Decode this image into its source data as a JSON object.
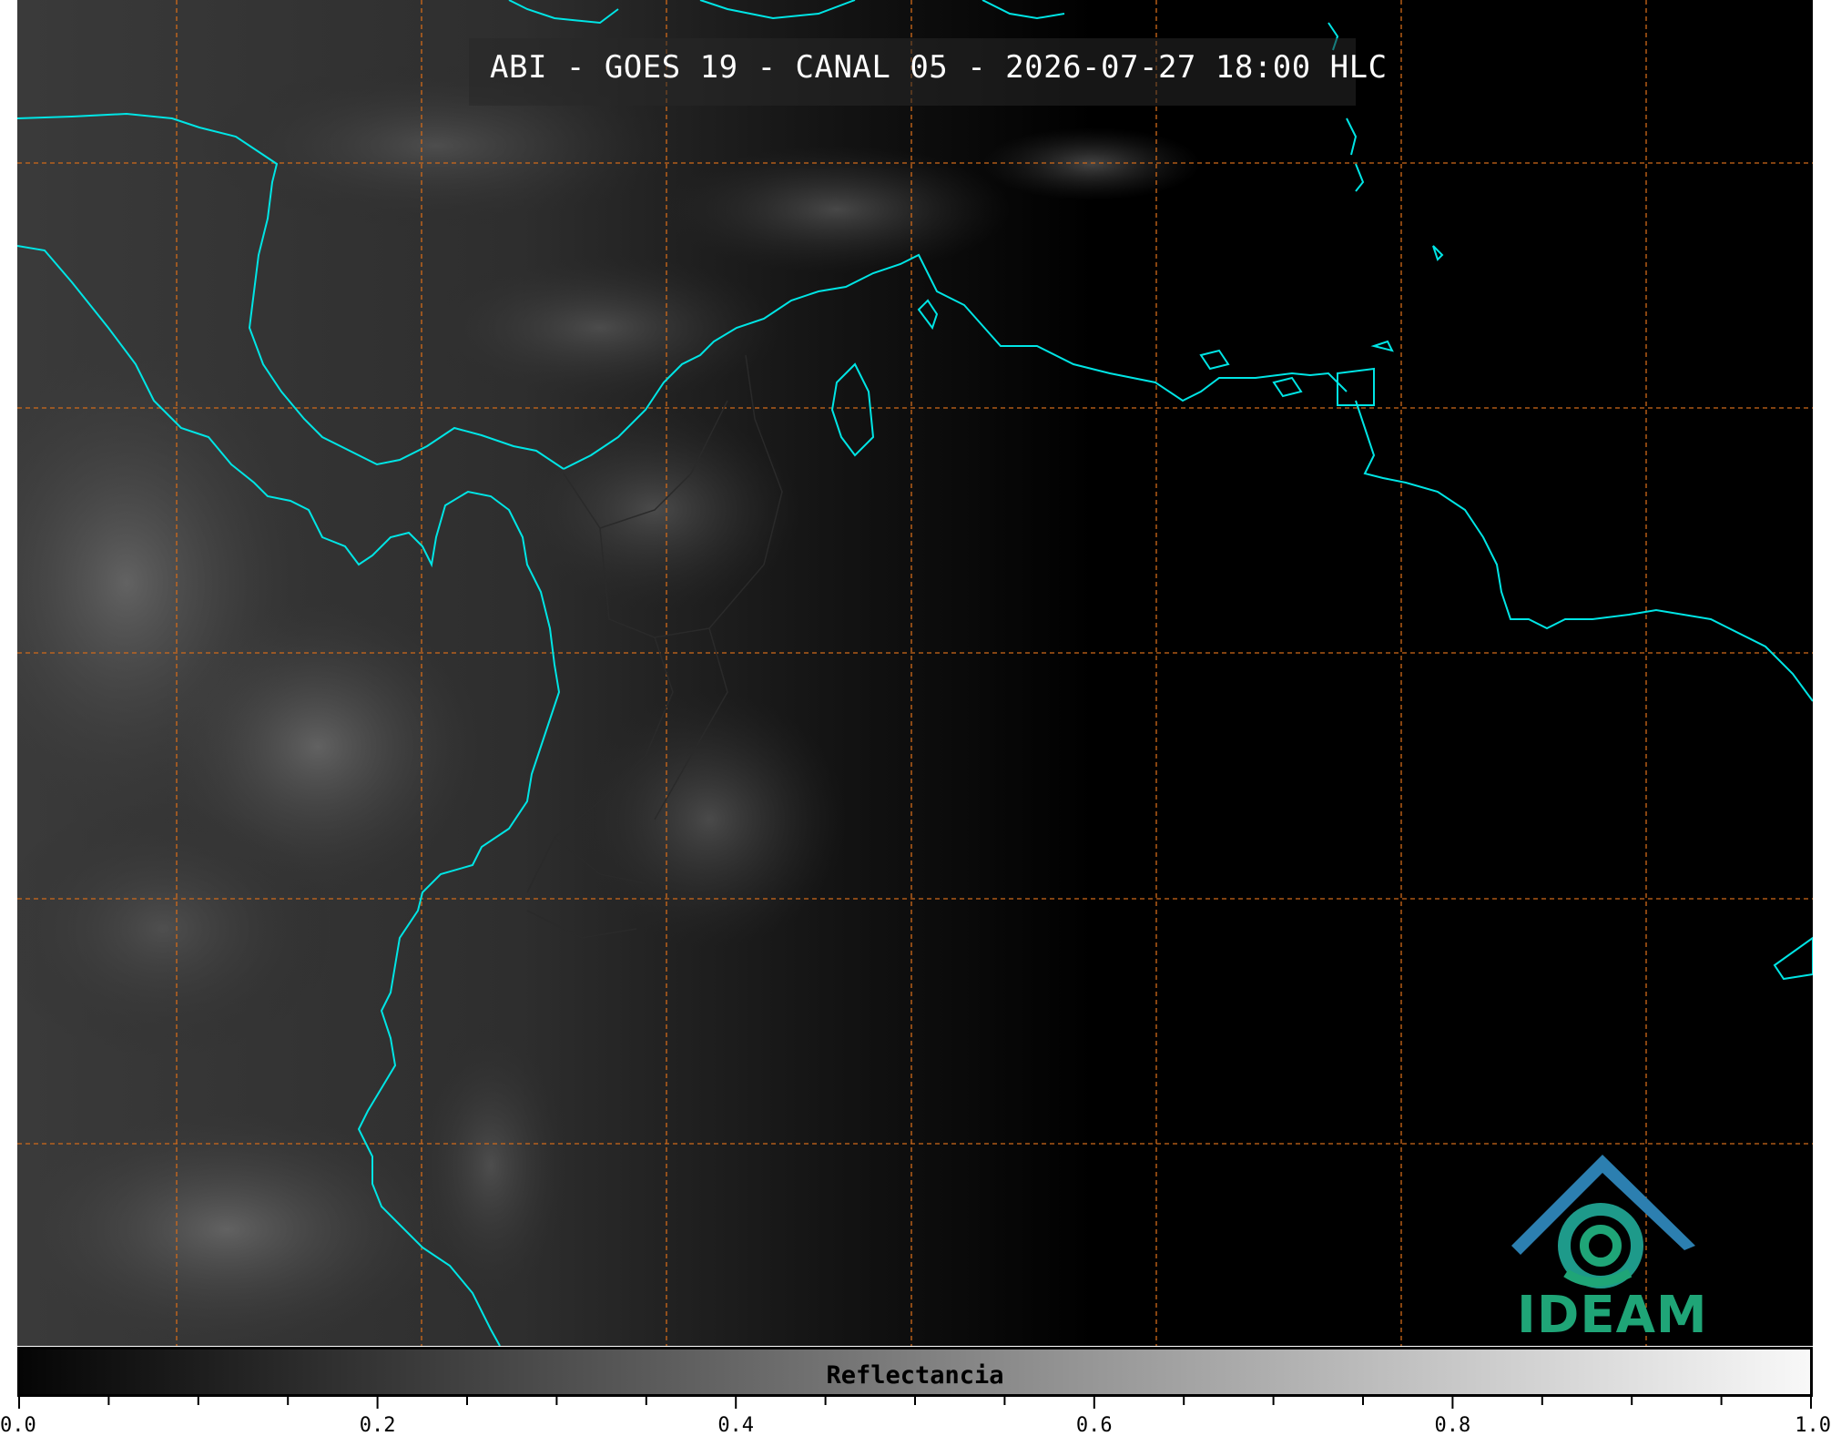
{
  "title": "ABI - GOES 19 - CANAL 05 - 2026-07-27 18:00 HLC",
  "logo": {
    "name": "IDEAM",
    "text": "IDEAM"
  },
  "colorbar": {
    "label": "Reflectancia",
    "ticks": [
      "0.0",
      "0.2",
      "0.4",
      "0.6",
      "0.8",
      "1.0"
    ],
    "gradient_from": "#050505",
    "gradient_to": "#f8f8f8"
  },
  "colors": {
    "coastline": "#00e5e5",
    "graticule": "#d06a1a",
    "borders": "#2a2a2a",
    "background": "#000000"
  }
}
